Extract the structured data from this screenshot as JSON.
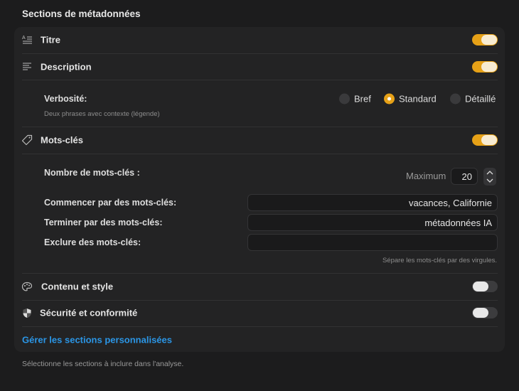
{
  "header": {
    "title": "Sections de métadonnées"
  },
  "sections": {
    "title": {
      "label": "Titre",
      "icon": "text-title-icon",
      "enabled": true
    },
    "description": {
      "label": "Description",
      "icon": "text-align-left-icon",
      "enabled": true,
      "verbosity_label": "Verbosité:",
      "verbosity_hint": "Deux phrases avec contexte (légende)",
      "options": [
        "Bref",
        "Standard",
        "Détaillé"
      ],
      "selected": "Standard"
    },
    "keywords": {
      "label": "Mots-clés",
      "icon": "tag-icon",
      "enabled": true,
      "count_label": "Nombre de mots-clés :",
      "max_label": "Maximum",
      "max_value": "20",
      "start_label": "Commencer par des mots-clés:",
      "start_value": "vacances, Californie",
      "end_label": "Terminer par des mots-clés:",
      "end_value": "métadonnées IA",
      "exclude_label": "Exclure des mots-clés:",
      "exclude_value": "",
      "hint": "Sépare les mots-clés par des virgules."
    },
    "content": {
      "label": "Contenu et style",
      "icon": "palette-icon",
      "enabled": false
    },
    "security": {
      "label": "Sécurité et conformité",
      "icon": "shield-icon",
      "enabled": false
    }
  },
  "manage_link": "Gérer les sections personnalisées",
  "footer": "Sélectionne les sections à inclure dans l'analyse.",
  "colors": {
    "accent": "#e6a117",
    "link": "#2b96e6",
    "background": "#1c1c1d",
    "card": "#232324"
  }
}
